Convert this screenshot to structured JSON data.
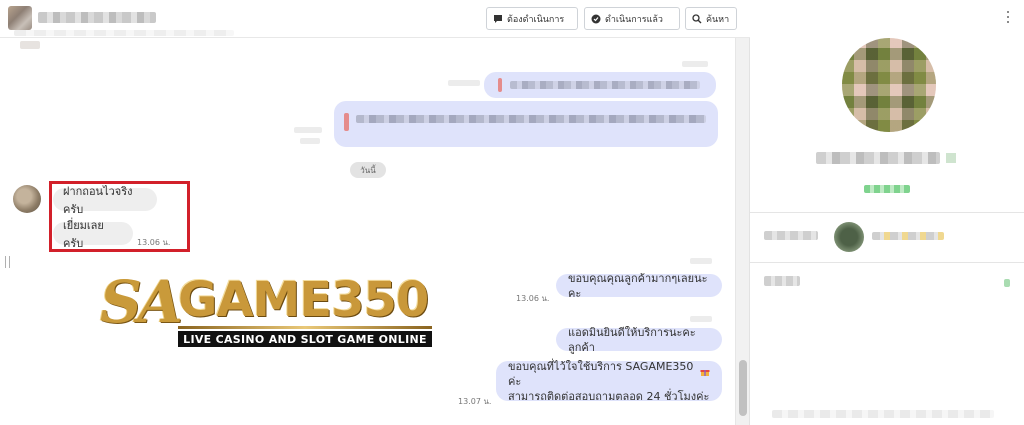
{
  "header": {
    "buttons": {
      "todo": "ต้องดำเนินการ",
      "done": "ดำเนินการแล้ว",
      "search": "ค้นหา"
    }
  },
  "chat": {
    "date_separator": "วันนี้",
    "incoming": [
      {
        "text": "ฝากถอนไวจริงครับ"
      },
      {
        "text": "เยี่ยมเลยครับ",
        "time": "13.06 น."
      }
    ],
    "outgoing": [
      {
        "text": "ขอบคุณคุณลูกค้ามากๆเลยนะคะ",
        "time": "13.06 น."
      },
      {
        "text": "แอดมินยินดีให้บริการนะคะลูกค้า"
      },
      {
        "line1": "ขอบคุณที่ไว้ใจใช้บริการ SAGAME350 ค่ะ",
        "line2": "สามารถติดต่อสอบถามตลอด 24 ชั่วโมงค่ะ",
        "time": "13.07 น."
      }
    ]
  },
  "logo": {
    "sa": "SA",
    "game": "GAME350",
    "tagline": "LIVE CASINO AND SLOT GAME ONLINE"
  },
  "colors": {
    "highlight": "#d2202a",
    "bubble_out": "#dfe3fb",
    "bubble_in": "#eeeeee",
    "logo_gold": "#c99a3a"
  },
  "icons": [
    "chat-bubble-icon",
    "check-chat-icon",
    "search-icon",
    "kebab-menu-icon",
    "gift-emoji-icon"
  ]
}
